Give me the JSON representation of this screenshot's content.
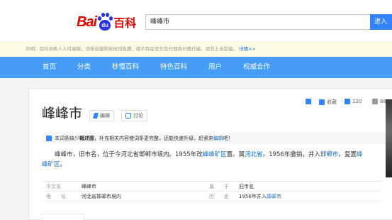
{
  "search": {
    "value": "峰峰市",
    "button_label": "进入"
  },
  "logo": {
    "left": "Bai",
    "paw": "du",
    "right": "百科"
  },
  "notice": {
    "text": "声明：百科词条人人可编辑，词条创建和修改均免费，绝不存在官方及代理商付费代编，请勿上当受骗。",
    "link": "详情>>"
  },
  "nav": {
    "items": [
      "首页",
      "分类",
      "秒懂百科",
      "特色百科",
      "用户",
      "权威合作"
    ]
  },
  "entry": {
    "title": "峰峰市",
    "edit_label": "编辑",
    "discuss_label": "讨论",
    "toolbar": {
      "star_label": "收藏",
      "like_count": "120",
      "share_count": "88"
    },
    "tip": {
      "pre": "本词条缺少",
      "bold": "概述图",
      "mid": "，补充相关内容使词条更完整，还能快速升级，赶紧来",
      "link": "编辑",
      "post": "吧！"
    },
    "paragraph": {
      "t1": "峰峰市，旧市名，位于今河北省邯郸市境内。1955年改",
      "l1": "峰峰矿区",
      "t2": "置。属",
      "l2": "河北省",
      "t3": "。1956年撤销，并入",
      "l3": "邯郸市",
      "t4": "，复置",
      "l4": "峰峰矿区",
      "t5": "。"
    },
    "basic_info": [
      {
        "k1": "中文名",
        "v1": "峰峰市",
        "k2": "属　　于",
        "v2": "旧市名"
      },
      {
        "k1": "地　　址",
        "v1": "河北省邯郸市境内",
        "k2": "历　　史",
        "v2": "1956年并入",
        "v2_link": "邯郸市"
      }
    ]
  }
}
